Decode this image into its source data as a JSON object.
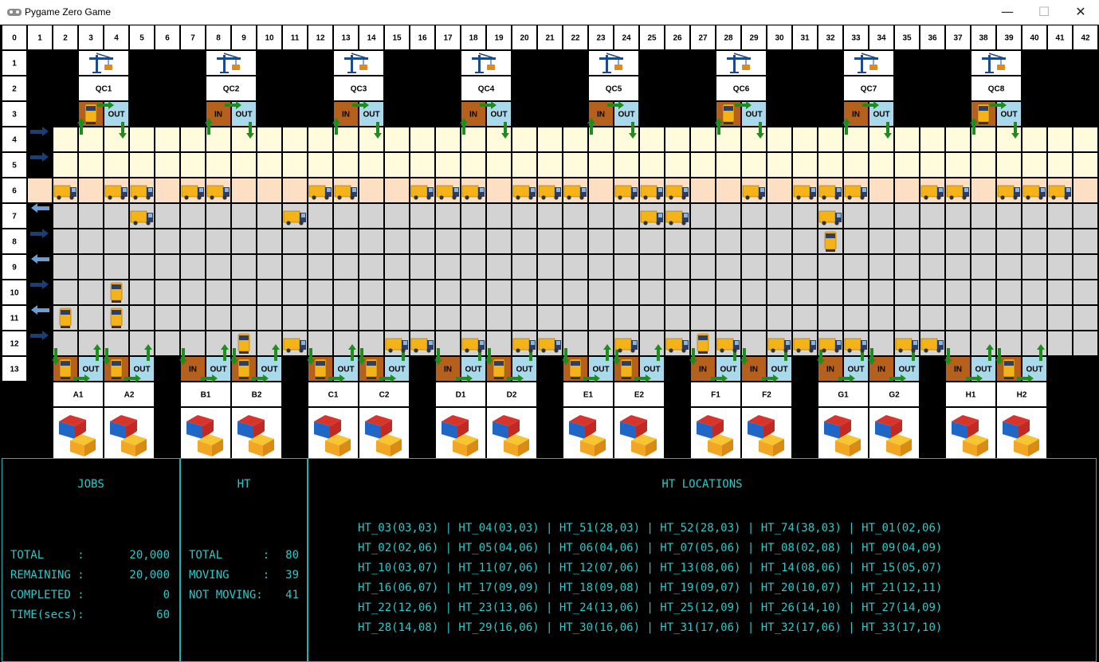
{
  "window": {
    "title": "Pygame Zero Game",
    "min_glyph": "—",
    "max_glyph": "☐",
    "close_glyph": "✕"
  },
  "grid": {
    "col_labels": [
      "0",
      "1",
      "2",
      "3",
      "4",
      "5",
      "6",
      "7",
      "8",
      "9",
      "10",
      "11",
      "12",
      "13",
      "14",
      "15",
      "16",
      "17",
      "18",
      "19",
      "20",
      "21",
      "22",
      "23",
      "24",
      "25",
      "26",
      "27",
      "28",
      "29",
      "30",
      "31",
      "32",
      "33",
      "34",
      "35",
      "36",
      "37",
      "38",
      "39",
      "40",
      "41",
      "42"
    ],
    "row_labels": [
      "1",
      "2",
      "3",
      "4",
      "5",
      "6",
      "7",
      "8",
      "9",
      "10",
      "11",
      "12",
      "13"
    ],
    "quay_cranes": [
      {
        "label": "QC1",
        "col": 3
      },
      {
        "label": "QC2",
        "col": 8
      },
      {
        "label": "QC3",
        "col": 13
      },
      {
        "label": "QC4",
        "col": 18
      },
      {
        "label": "QC5",
        "col": 23
      },
      {
        "label": "QC6",
        "col": 28
      },
      {
        "label": "QC7",
        "col": 33
      },
      {
        "label": "QC8",
        "col": 38
      }
    ],
    "yard_blocks": [
      {
        "label": "A1",
        "col": 2
      },
      {
        "label": "A2",
        "col": 4
      },
      {
        "label": "B1",
        "col": 7
      },
      {
        "label": "B2",
        "col": 9
      },
      {
        "label": "C1",
        "col": 12
      },
      {
        "label": "C2",
        "col": 14
      },
      {
        "label": "D1",
        "col": 17
      },
      {
        "label": "D2",
        "col": 19
      },
      {
        "label": "E1",
        "col": 22
      },
      {
        "label": "E2",
        "col": 24
      },
      {
        "label": "F1",
        "col": 27
      },
      {
        "label": "F2",
        "col": 29
      },
      {
        "label": "G1",
        "col": 32
      },
      {
        "label": "G2",
        "col": 34
      },
      {
        "label": "H1",
        "col": 37
      },
      {
        "label": "H2",
        "col": 39
      }
    ],
    "in_label": "IN",
    "out_label": "OUT",
    "lane_directions": {
      "4": "right",
      "5": "right",
      "7": "left",
      "8": "right",
      "9": "left",
      "10": "right",
      "11": "left",
      "12": "right"
    },
    "trucks": [
      {
        "col": 3,
        "row": 3,
        "dir": "v"
      },
      {
        "col": 28,
        "row": 3,
        "dir": "v"
      },
      {
        "col": 38,
        "row": 3,
        "dir": "v"
      },
      {
        "col": 2,
        "row": 6,
        "dir": "h"
      },
      {
        "col": 4,
        "row": 6,
        "dir": "h"
      },
      {
        "col": 5,
        "row": 6,
        "dir": "h"
      },
      {
        "col": 7,
        "row": 6,
        "dir": "h"
      },
      {
        "col": 8,
        "row": 6,
        "dir": "h"
      },
      {
        "col": 12,
        "row": 6,
        "dir": "h"
      },
      {
        "col": 13,
        "row": 6,
        "dir": "h"
      },
      {
        "col": 16,
        "row": 6,
        "dir": "h"
      },
      {
        "col": 17,
        "row": 6,
        "dir": "h"
      },
      {
        "col": 18,
        "row": 6,
        "dir": "h"
      },
      {
        "col": 20,
        "row": 6,
        "dir": "h"
      },
      {
        "col": 21,
        "row": 6,
        "dir": "h"
      },
      {
        "col": 22,
        "row": 6,
        "dir": "h"
      },
      {
        "col": 24,
        "row": 6,
        "dir": "h"
      },
      {
        "col": 25,
        "row": 6,
        "dir": "h"
      },
      {
        "col": 26,
        "row": 6,
        "dir": "h"
      },
      {
        "col": 29,
        "row": 6,
        "dir": "h"
      },
      {
        "col": 31,
        "row": 6,
        "dir": "h"
      },
      {
        "col": 32,
        "row": 6,
        "dir": "h"
      },
      {
        "col": 33,
        "row": 6,
        "dir": "h"
      },
      {
        "col": 36,
        "row": 6,
        "dir": "h"
      },
      {
        "col": 37,
        "row": 6,
        "dir": "h"
      },
      {
        "col": 39,
        "row": 6,
        "dir": "h"
      },
      {
        "col": 40,
        "row": 6,
        "dir": "h"
      },
      {
        "col": 41,
        "row": 6,
        "dir": "h"
      },
      {
        "col": 5,
        "row": 7,
        "dir": "h"
      },
      {
        "col": 11,
        "row": 7,
        "dir": "h"
      },
      {
        "col": 25,
        "row": 7,
        "dir": "h"
      },
      {
        "col": 26,
        "row": 7,
        "dir": "h"
      },
      {
        "col": 32,
        "row": 7,
        "dir": "h"
      },
      {
        "col": 32,
        "row": 8,
        "dir": "v"
      },
      {
        "col": 4,
        "row": 10,
        "dir": "v"
      },
      {
        "col": 2,
        "row": 11,
        "dir": "v"
      },
      {
        "col": 4,
        "row": 11,
        "dir": "v"
      },
      {
        "col": 9,
        "row": 12,
        "dir": "v"
      },
      {
        "col": 11,
        "row": 12,
        "dir": "h"
      },
      {
        "col": 15,
        "row": 12,
        "dir": "h"
      },
      {
        "col": 16,
        "row": 12,
        "dir": "h"
      },
      {
        "col": 18,
        "row": 12,
        "dir": "h"
      },
      {
        "col": 20,
        "row": 12,
        "dir": "h"
      },
      {
        "col": 21,
        "row": 12,
        "dir": "h"
      },
      {
        "col": 24,
        "row": 12,
        "dir": "h"
      },
      {
        "col": 26,
        "row": 12,
        "dir": "h"
      },
      {
        "col": 27,
        "row": 12,
        "dir": "v"
      },
      {
        "col": 28,
        "row": 12,
        "dir": "h"
      },
      {
        "col": 30,
        "row": 12,
        "dir": "h"
      },
      {
        "col": 31,
        "row": 12,
        "dir": "h"
      },
      {
        "col": 32,
        "row": 12,
        "dir": "h"
      },
      {
        "col": 33,
        "row": 12,
        "dir": "h"
      },
      {
        "col": 35,
        "row": 12,
        "dir": "h"
      },
      {
        "col": 36,
        "row": 12,
        "dir": "h"
      },
      {
        "col": 2,
        "row": 13,
        "dir": "v"
      },
      {
        "col": 4,
        "row": 13,
        "dir": "v"
      },
      {
        "col": 9,
        "row": 13,
        "dir": "v"
      },
      {
        "col": 12,
        "row": 13,
        "dir": "v"
      },
      {
        "col": 14,
        "row": 13,
        "dir": "v"
      },
      {
        "col": 19,
        "row": 13,
        "dir": "v"
      },
      {
        "col": 22,
        "row": 13,
        "dir": "v"
      },
      {
        "col": 24,
        "row": 13,
        "dir": "v"
      },
      {
        "col": 39,
        "row": 13,
        "dir": "v"
      }
    ],
    "colors": {
      "cell_border": "#000000",
      "header_cell": "#ffffff",
      "yellow_lane": "#fffbdc",
      "row6_lane": "#fde0c4",
      "grey_lane": "#d3d3d3",
      "in_cell": "#b5601c",
      "out_cell": "#a9d9ea",
      "arrow_green": "#1e8c1e",
      "arrow_dark_blue": "#173f7a",
      "arrow_light_blue": "#6c9ed6",
      "truck_body": "#f5b31a",
      "truck_cab": "#2c3e66"
    }
  },
  "jobs": {
    "title": "JOBS",
    "rows": [
      {
        "label": "TOTAL     :",
        "value": "20,000"
      },
      {
        "label": "REMAINING :",
        "value": "20,000"
      },
      {
        "label": "COMPLETED :",
        "value": "0"
      },
      {
        "label": "TIME(secs):",
        "value": "60"
      }
    ]
  },
  "ht": {
    "title": "HT",
    "rows": [
      {
        "label": "TOTAL      :",
        "value": "80"
      },
      {
        "label": "MOVING     :",
        "value": "39"
      },
      {
        "label": "NOT MOVING:",
        "value": "41"
      }
    ]
  },
  "ht_locations": {
    "title": "HT LOCATIONS",
    "lines": [
      "HT_03(03,03) | HT_04(03,03) | HT_51(28,03) | HT_52(28,03) | HT_74(38,03) | HT_01(02,06)",
      "HT_02(02,06) | HT_05(04,06) | HT_06(04,06) | HT_07(05,06) | HT_08(02,08) | HT_09(04,09)",
      "HT_10(03,07) | HT_11(07,06) | HT_12(07,06) | HT_13(08,06) | HT_14(08,06) | HT_15(05,07)",
      "HT_16(06,07) | HT_17(09,09) | HT_18(09,08) | HT_19(09,07) | HT_20(10,07) | HT_21(12,11)",
      "HT_22(12,06) | HT_23(13,06) | HT_24(13,06) | HT_25(12,09) | HT_26(14,10) | HT_27(14,09)",
      "HT_28(14,08) | HT_29(16,06) | HT_30(16,06) | HT_31(17,06) | HT_32(17,06) | HT_33(17,10)"
    ]
  }
}
